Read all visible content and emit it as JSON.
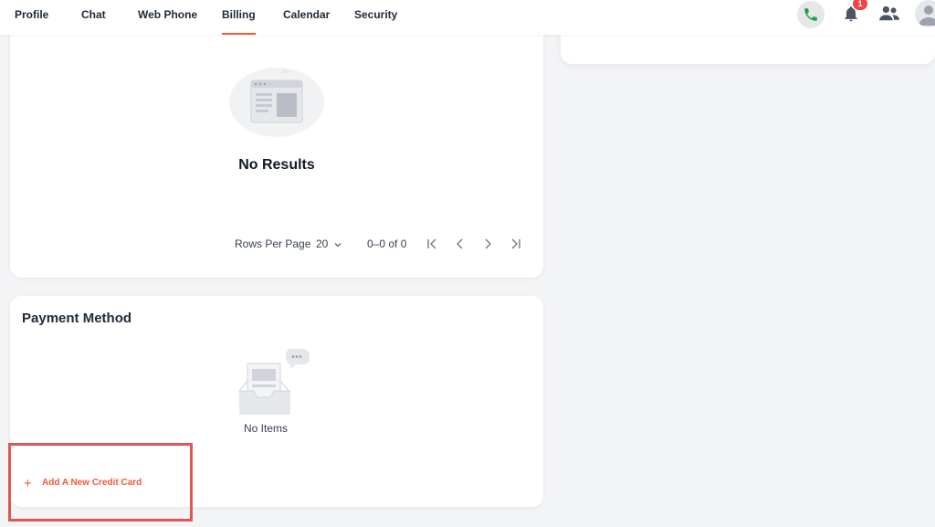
{
  "nav": {
    "tabs": [
      {
        "label": "Profile"
      },
      {
        "label": "Chat"
      },
      {
        "label": "Web Phone"
      },
      {
        "label": "Billing"
      },
      {
        "label": "Calendar"
      },
      {
        "label": "Security"
      }
    ],
    "active_tab": "Billing",
    "notification_count": "1",
    "icons": [
      "phone-icon",
      "bell-icon",
      "people-icon",
      "avatar"
    ]
  },
  "invoices": {
    "empty_text": "No Results",
    "pagination": {
      "rows_per_page_label": "Rows Per Page",
      "rows_per_page_value": "20",
      "range_text": "0–0 of 0"
    }
  },
  "payment_method": {
    "title": "Payment Method",
    "empty_text": "No Items",
    "add_label": "Add A New Credit Card"
  },
  "colors": {
    "accent": "#ef5a35",
    "call_green": "#16a34a",
    "badge_red": "#ef4444",
    "highlight_red": "#e25555"
  }
}
